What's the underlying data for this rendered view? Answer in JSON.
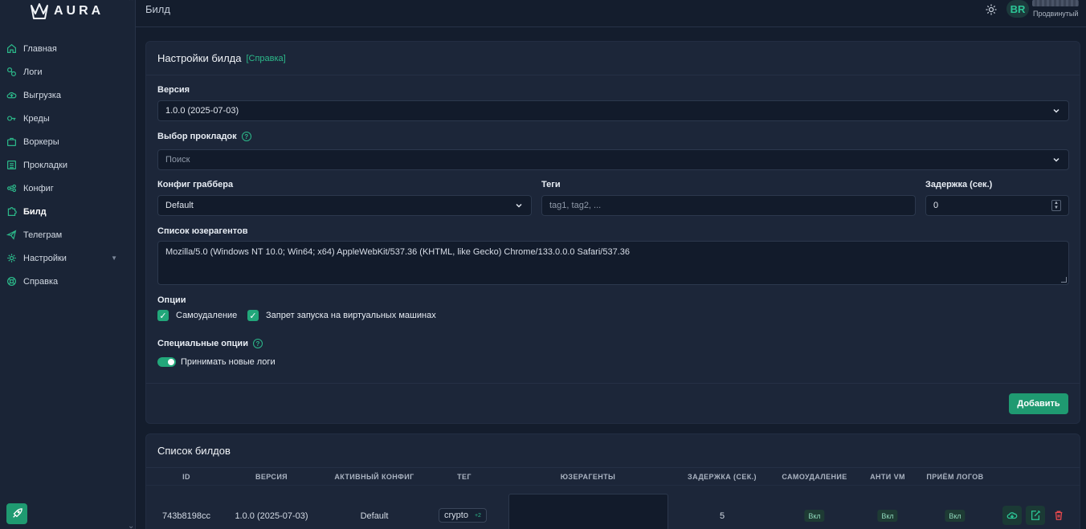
{
  "brand": {
    "logo_text": "AURA",
    "accent": "#1f9a71"
  },
  "header": {
    "title": "Билд",
    "avatar_initials": "BR",
    "user_role": "Продвинутый"
  },
  "sidebar": {
    "items": [
      {
        "label": "Главная",
        "icon": "home-icon"
      },
      {
        "label": "Логи",
        "icon": "logs-icon"
      },
      {
        "label": "Выгрузка",
        "icon": "cloud-upload-icon"
      },
      {
        "label": "Креды",
        "icon": "key-icon"
      },
      {
        "label": "Воркеры",
        "icon": "briefcase-icon"
      },
      {
        "label": "Прокладки",
        "icon": "list-icon"
      },
      {
        "label": "Конфиг",
        "icon": "sliders-icon"
      },
      {
        "label": "Билд",
        "icon": "puzzle-icon"
      },
      {
        "label": "Телеграм",
        "icon": "send-icon"
      },
      {
        "label": "Настройки",
        "icon": "gear-icon"
      },
      {
        "label": "Справка",
        "icon": "help-icon"
      }
    ],
    "active_index": 7
  },
  "settings": {
    "title": "Настройки билда",
    "help_link": "[Справка]",
    "version_label": "Версия",
    "version_value": "1.0.0 (2025-07-03)",
    "proxies_label": "Выбор прокладок",
    "proxies_placeholder": "Поиск",
    "grabber_label": "Конфиг граббера",
    "grabber_value": "Default",
    "tags_label": "Теги",
    "tags_placeholder": "tag1, tag2, ...",
    "delay_label": "Задержка (сек.)",
    "delay_value": "0",
    "ua_label": "Список юзерагентов",
    "ua_value": "Mozilla/5.0 (Windows NT 10.0; Win64; x64) AppleWebKit/537.36 (KHTML, like Gecko) Chrome/133.0.0.0 Safari/537.36",
    "options_label": "Опции",
    "opt_selfdelete": "Самоудаление",
    "opt_antivm": "Запрет запуска на виртуальных машинах",
    "special_label": "Специальные опции",
    "special_accept_logs": "Принимать новые логи",
    "add_button": "Добавить"
  },
  "builds": {
    "title": "Список билдов",
    "columns": [
      "ID",
      "ВЕРСИЯ",
      "АКТИВНЫЙ КОНФИГ",
      "ТЕГ",
      "ЮЗЕРАГЕНТЫ",
      "ЗАДЕРЖКА (СЕК.)",
      "САМОУДАЛЕНИЕ",
      "АНТИ VM",
      "ПРИЁМ ЛОГОВ"
    ],
    "rows": [
      {
        "id": "743b8198cc",
        "version": "1.0.0 (2025-07-03)",
        "config": "Default",
        "tag": "crypto",
        "tag_more": "+2",
        "delay": "5",
        "selfdelete": "Вкл",
        "antivm": "Вкл",
        "accept_logs": "Вкл"
      }
    ]
  }
}
